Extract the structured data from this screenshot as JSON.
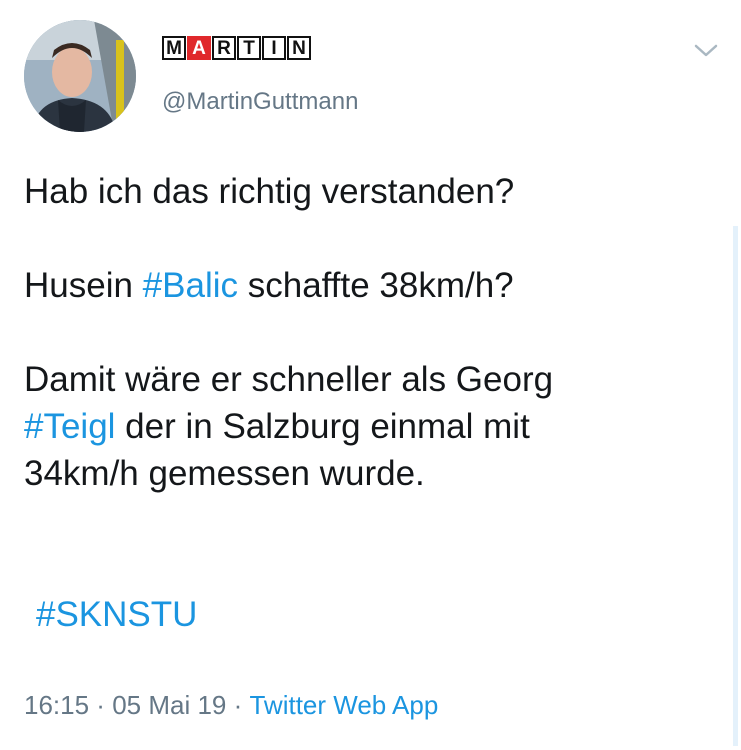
{
  "author": {
    "display_name_letters": [
      "M",
      "A",
      "R",
      "T",
      "I",
      "N"
    ],
    "highlighted_letter_index": 1,
    "handle": "@MartinGuttmann"
  },
  "tweet": {
    "line1": "Hab ich das richtig verstanden?",
    "line2_prefix": "Husein ",
    "hashtag_balic": "#Balic",
    "line2_suffix": " schaffte 38km/h?",
    "line3": "Damit wäre er schneller als Georg",
    "hashtag_teigl": "#Teigl",
    "line4_suffix": " der in Salzburg einmal mit",
    "line5": "34km/h gemessen wurde.",
    "hashtag_skn": "#SKNSTU"
  },
  "meta": {
    "time": "16:15",
    "separator": " · ",
    "date": "05 Mai 19",
    "source": "Twitter Web App"
  },
  "colors": {
    "link": "#1b95e0",
    "secondary_text": "#657786",
    "highlight_letter_bg": "#e0282b"
  },
  "icons": {
    "menu": "chevron-down-icon"
  }
}
